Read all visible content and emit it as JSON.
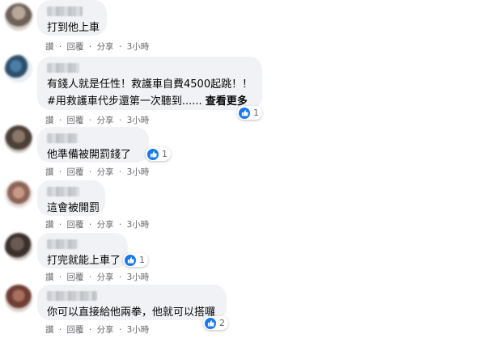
{
  "actions": {
    "like": "讚",
    "reply": "回覆",
    "share": "分享",
    "sep": "·"
  },
  "comments": [
    {
      "text": "打到他上車",
      "time": "3小時",
      "reactions": ""
    },
    {
      "text": "有錢人就是任性！救護車自費4500起跳！！",
      "text2": "#用救護車代步還第一次聽到......",
      "see_more": "查看更多",
      "time": "3小時",
      "reactions": "1"
    },
    {
      "text": "他準備被開罰錢了",
      "time": "3小時",
      "reactions": "1"
    },
    {
      "text": "這會被開罰",
      "time": "3小時",
      "reactions": ""
    },
    {
      "text": "打完就能上車了",
      "time": "3小時",
      "reactions": "1"
    },
    {
      "text": "你可以直接給他兩拳，他就可以搭囉",
      "time": "3小時",
      "reactions": "2"
    }
  ],
  "colors": {
    "bubble": "#f0f2f5",
    "meta": "#65676b",
    "like": "#1877f2"
  },
  "icons": {
    "reaction": "like-icon"
  }
}
